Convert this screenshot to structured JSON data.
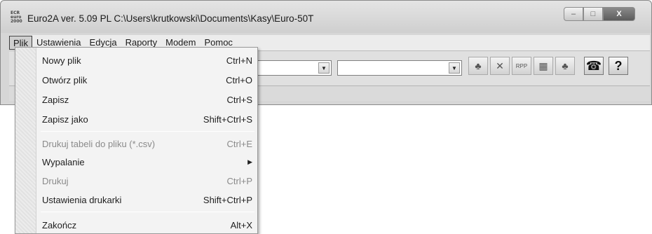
{
  "window": {
    "title": "Euro2A ver. 5.09 PL   C:\\Users\\krutkowski\\Documents\\Kasy\\Euro-50T",
    "app_icon_text": "ECR euro 2000",
    "controls": {
      "minimize": "–",
      "maximize": "□",
      "close": "X"
    }
  },
  "menubar": [
    "Plik",
    "Ustawienia",
    "Edycja",
    "Raporty",
    "Modem",
    "Pomoc"
  ],
  "toolbar": {
    "combo1_value": "",
    "combo2_value": "",
    "buttons": [
      {
        "icon": "tree-icon",
        "glyph": "♣"
      },
      {
        "icon": "cross-icon",
        "glyph": "✕"
      },
      {
        "icon": "rep-plu-icon",
        "glyph": "RPP"
      },
      {
        "icon": "grid-icon",
        "glyph": "▦"
      },
      {
        "icon": "tree-icon",
        "glyph": "♣"
      },
      {
        "icon": "phone-icon",
        "glyph": "☎"
      },
      {
        "icon": "help-icon",
        "glyph": "?"
      }
    ]
  },
  "plik_menu": {
    "items": [
      {
        "label": "Nowy plik",
        "shortcut": "Ctrl+N",
        "disabled": false
      },
      {
        "label": "Otwórz plik",
        "shortcut": "Ctrl+O",
        "disabled": false
      },
      {
        "label": "Zapisz",
        "shortcut": "Ctrl+S",
        "disabled": false
      },
      {
        "label": "Zapisz jako",
        "shortcut": "Shift+Ctrl+S",
        "disabled": false
      },
      {
        "label": "Drukuj tabeli do pliku (*.csv)",
        "shortcut": "Ctrl+E",
        "disabled": true
      },
      {
        "label": "Wypalanie",
        "shortcut": "",
        "disabled": false,
        "submenu": true
      },
      {
        "label": "Drukuj",
        "shortcut": "Ctrl+P",
        "disabled": true
      },
      {
        "label": "Ustawienia drukarki",
        "shortcut": "Shift+Ctrl+P",
        "disabled": false
      },
      {
        "label": "Zakończ",
        "shortcut": "Alt+X",
        "disabled": false
      }
    ]
  }
}
